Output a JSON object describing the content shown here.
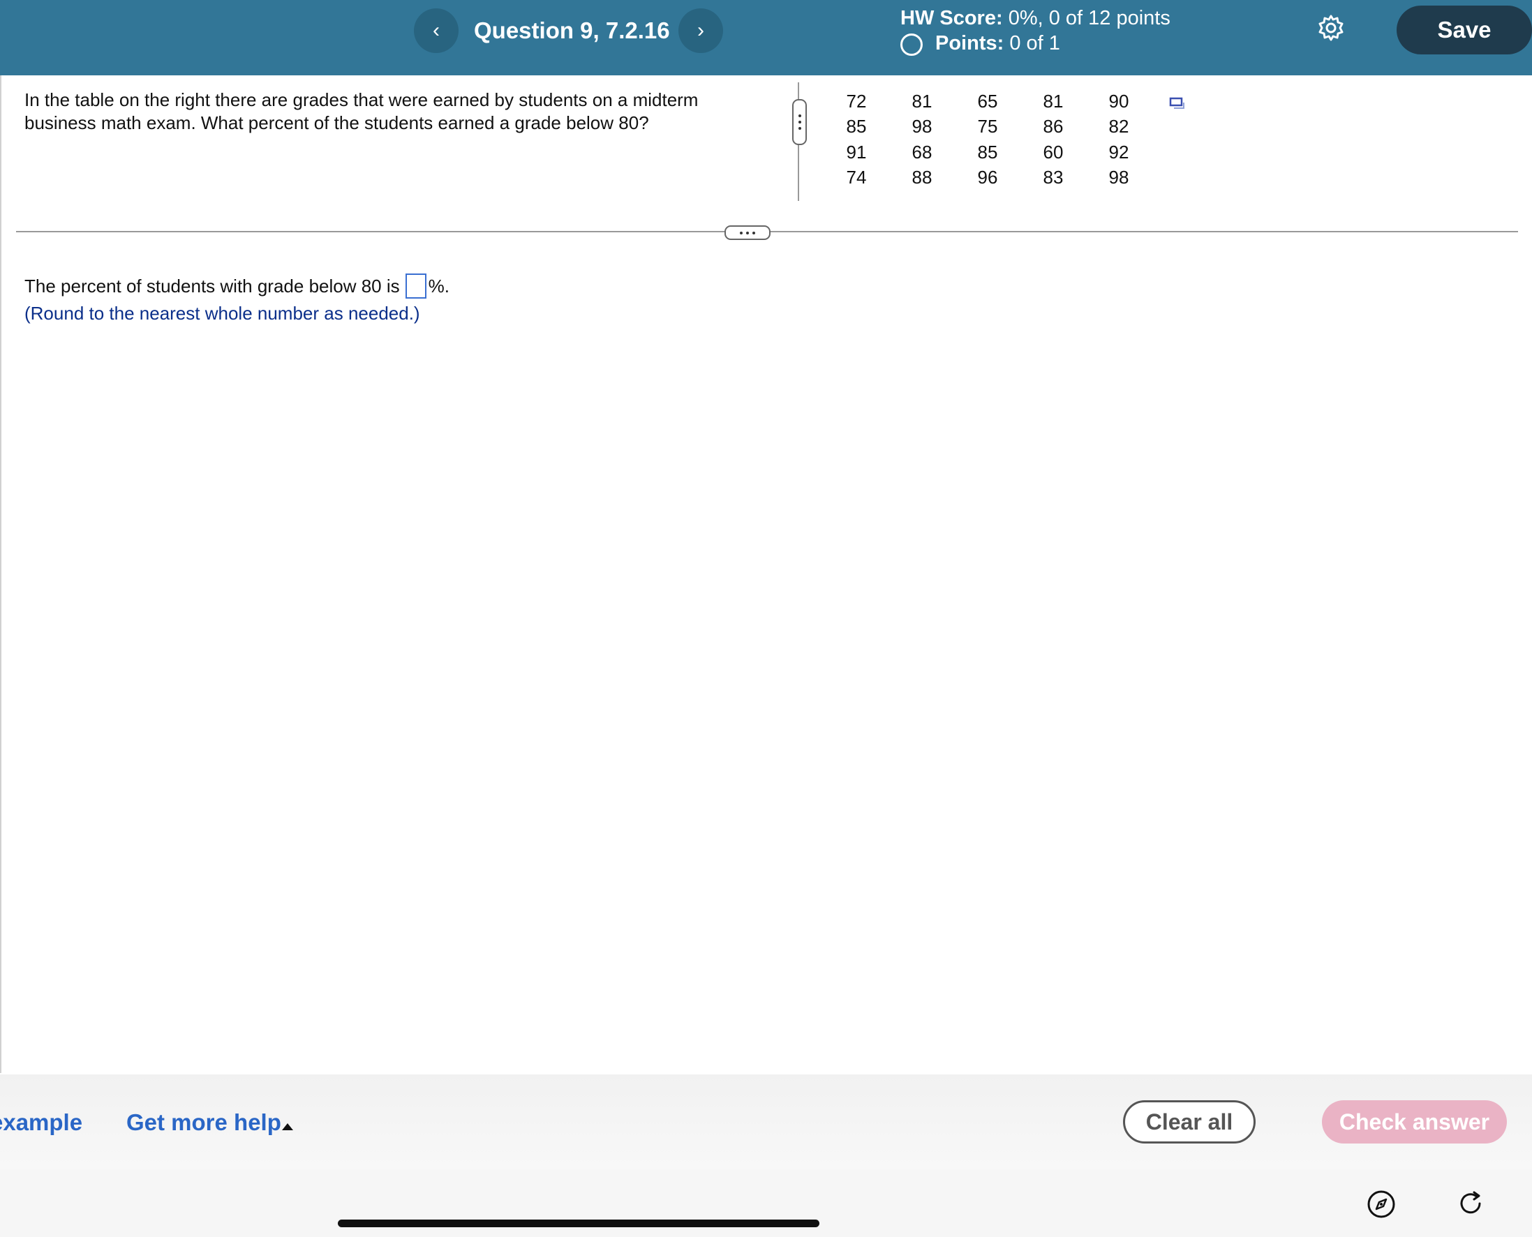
{
  "header": {
    "question_title": "Question 9, 7.2.16",
    "prev_icon": "chevron-left-icon",
    "next_icon": "chevron-right-icon",
    "prev_glyph": "‹",
    "next_glyph": "›",
    "hw_score_label": "HW Score:",
    "hw_score_value": "0%, 0 of 12 points",
    "points_label": "Points:",
    "points_value": "0 of 1",
    "settings_icon": "gear-icon",
    "save_label": "Save",
    "bg_color": "#327697"
  },
  "question": {
    "text": "In the table on the right there are grades that  were earned by students on a midterm business math exam. What percent of the students earned a grade below 80?",
    "grades": [
      [
        "72",
        "81",
        "65",
        "81",
        "90"
      ],
      [
        "85",
        "98",
        "75",
        "86",
        "82"
      ],
      [
        "91",
        "68",
        "85",
        "60",
        "92"
      ],
      [
        "74",
        "88",
        "96",
        "83",
        "98"
      ]
    ],
    "copy_icon": "copy-data-icon"
  },
  "answer": {
    "prefix": "The percent of students with grade below 80 is",
    "value": "",
    "suffix": "%.",
    "hint": "(Round to the nearest whole number as needed.)"
  },
  "footer": {
    "example_label": "example",
    "help_label": "Get more help",
    "clear_label": "Clear all",
    "check_label": "Check answer",
    "check_color": "#eab3c5",
    "link_color": "#2a66c6"
  },
  "system_bar": {
    "compass_icon": "compass-icon",
    "reload_icon": "reload-icon"
  }
}
